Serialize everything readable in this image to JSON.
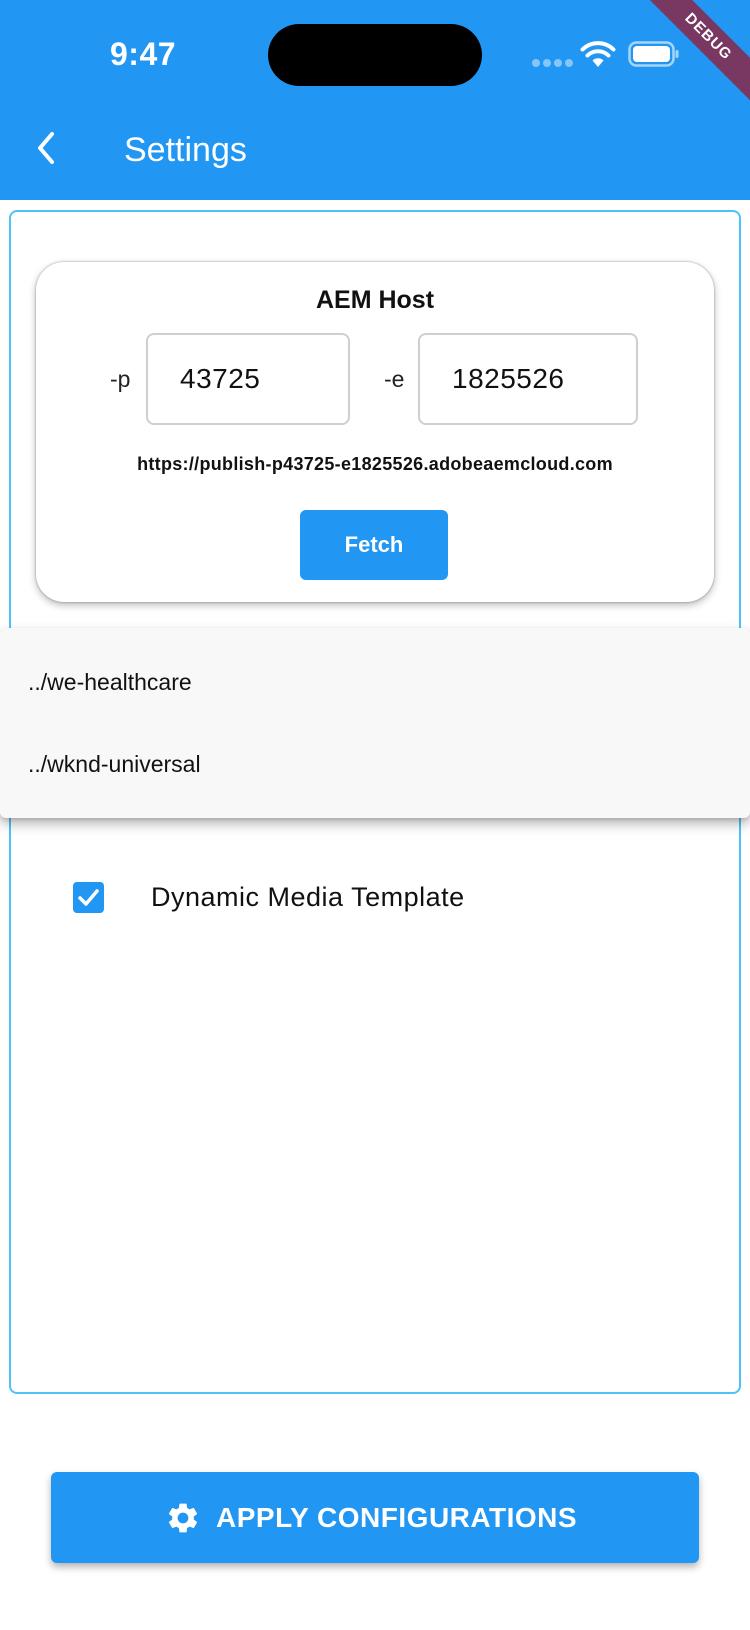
{
  "status_bar": {
    "time": "9:47"
  },
  "debug_banner": "DEBUG",
  "app_bar": {
    "title": "Settings",
    "back_icon": "chevron-left-icon"
  },
  "host_card": {
    "title": "AEM Host",
    "program_prefix": "-p",
    "program_value": "43725",
    "environment_prefix": "-e",
    "environment_value": "1825526",
    "url": "https://publish-p43725-e1825526.adobeaemcloud.com",
    "fetch_label": "Fetch"
  },
  "dropdown": {
    "items": [
      {
        "label": "../we-healthcare"
      },
      {
        "label": "../wknd-universal"
      }
    ]
  },
  "options": {
    "dynamic_media_label": "Dynamic Media Template",
    "dynamic_media_checked": true
  },
  "apply_button": {
    "label": "APPLY CONFIGURATIONS",
    "icon": "gear-icon"
  },
  "colors": {
    "primary": "#2196F3",
    "panel_border": "#4FC3F7",
    "debug_ribbon": "#9B1428"
  }
}
